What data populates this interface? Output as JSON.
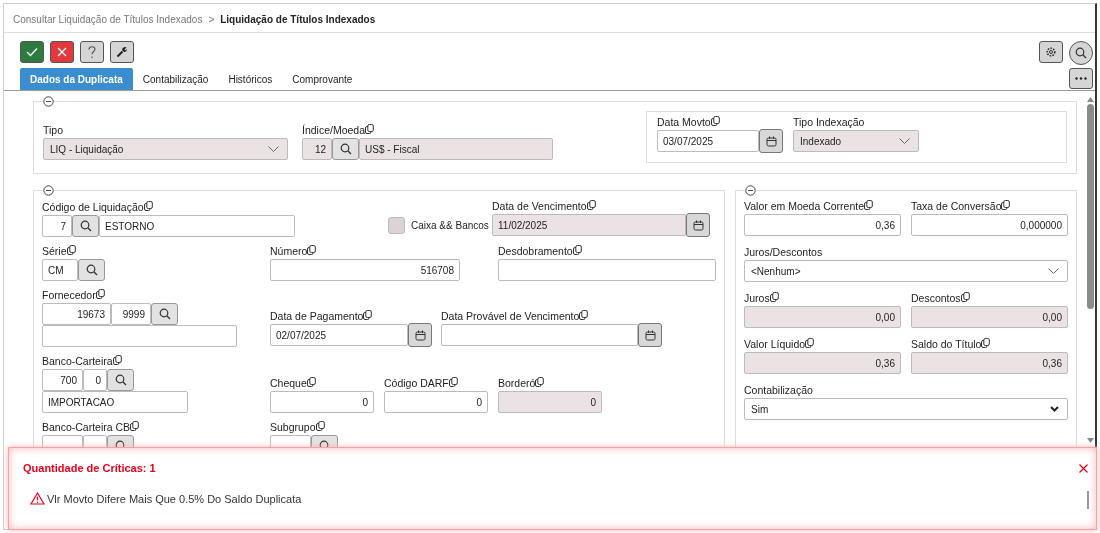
{
  "breadcrumb": {
    "parent": "Consultar Liquidação de Títulos Indexados",
    "separator": ">",
    "current": "Liquidação de Títulos Indexados"
  },
  "tabs": [
    {
      "label": "Dados da Duplicata",
      "selected": true
    },
    {
      "label": "Contabilização",
      "selected": false
    },
    {
      "label": "Históricos",
      "selected": false
    },
    {
      "label": "Comprovante",
      "selected": false
    }
  ],
  "header_section": {
    "tipo": {
      "label": "Tipo",
      "value": "LIQ - Liquidação",
      "readonly": true
    },
    "indice_moeda": {
      "label": "Índice/Moeda",
      "code": "12",
      "description": "US$ - Fiscal",
      "readonly": true,
      "copyable": true
    },
    "data_movto": {
      "label": "Data Movto",
      "value": "03/07/2025",
      "readonly": false,
      "copyable": true
    },
    "tipo_indexacao": {
      "label": "Tipo Indexação",
      "value": "Indexado",
      "readonly": true
    }
  },
  "document_section": {
    "codigo_liquidacao": {
      "label": "Código de Liquidação",
      "code": "7",
      "description": "ESTORNO",
      "readonly": false,
      "copyable": true
    },
    "caixa_bancos": {
      "label": "Caixa && Bancos",
      "checked": false,
      "disabled": true
    },
    "data_vencimento": {
      "label": "Data de Vencimento",
      "value": "11/02/2025",
      "readonly": true,
      "copyable": true
    },
    "serie": {
      "label": "Série",
      "code": "CM",
      "readonly": false,
      "copyable": true
    },
    "numero": {
      "label": "Número",
      "value": "516708",
      "readonly": false,
      "copyable": true
    },
    "desdobramento": {
      "label": "Desdobramento",
      "readonly": false,
      "copyable": true
    },
    "fornecedor": {
      "label": "Fornecedor",
      "codes": [
        "19673",
        "9999"
      ],
      "readonly": false,
      "copyable": true
    },
    "data_pagamento": {
      "label": "Data de Pagamento",
      "value": "02/07/2025",
      "readonly": false,
      "copyable": true
    },
    "data_provavel_vencimento": {
      "label": "Data Provável de Vencimento",
      "readonly": false,
      "copyable": true
    },
    "banco_carteira": {
      "label": "Banco-Carteira",
      "codes": [
        "700",
        "0"
      ],
      "description": "IMPORTACAO",
      "readonly": false,
      "copyable": true
    },
    "cheque": {
      "label": "Cheque",
      "value": "0",
      "readonly": false,
      "copyable": true
    },
    "codigo_darf": {
      "label": "Código DARF",
      "value": "0",
      "readonly": false,
      "copyable": true
    },
    "bordero": {
      "label": "Borderó",
      "value": "0",
      "readonly": true,
      "copyable": true
    },
    "banco_carteira_cb": {
      "label": "Banco-Carteira CB",
      "copyable": true
    },
    "subgrupo": {
      "label": "Subgrupo",
      "copyable": true
    }
  },
  "values_section": {
    "valor_moeda_corrente": {
      "label": "Valor em Moeda Corrente",
      "value": "0,36",
      "readonly": false,
      "copyable": true
    },
    "taxa_conversao": {
      "label": "Taxa de Conversão",
      "value": "0,000000",
      "readonly": false,
      "copyable": true
    },
    "juros_descontos": {
      "label": "Juros/Descontos",
      "value": "<Nenhum>",
      "readonly": false
    },
    "juros": {
      "label": "Juros",
      "value": "0,00",
      "readonly": true,
      "copyable": true
    },
    "descontos": {
      "label": "Descontos",
      "value": "0,00",
      "readonly": true,
      "copyable": true
    },
    "valor_liquido": {
      "label": "Valor Líquido",
      "value": "0,36",
      "readonly": true,
      "copyable": true
    },
    "saldo_titulo": {
      "label": "Saldo do Título",
      "value": "0,36",
      "readonly": true,
      "copyable": true
    },
    "contabilizacao": {
      "label": "Contabilização",
      "value": "Sim",
      "readonly": false
    }
  },
  "alert": {
    "title": "Quantidade de Críticas: 1",
    "messages": [
      "Vlr Movto Difere Mais Que 0.5% Do Saldo Duplicata"
    ]
  }
}
